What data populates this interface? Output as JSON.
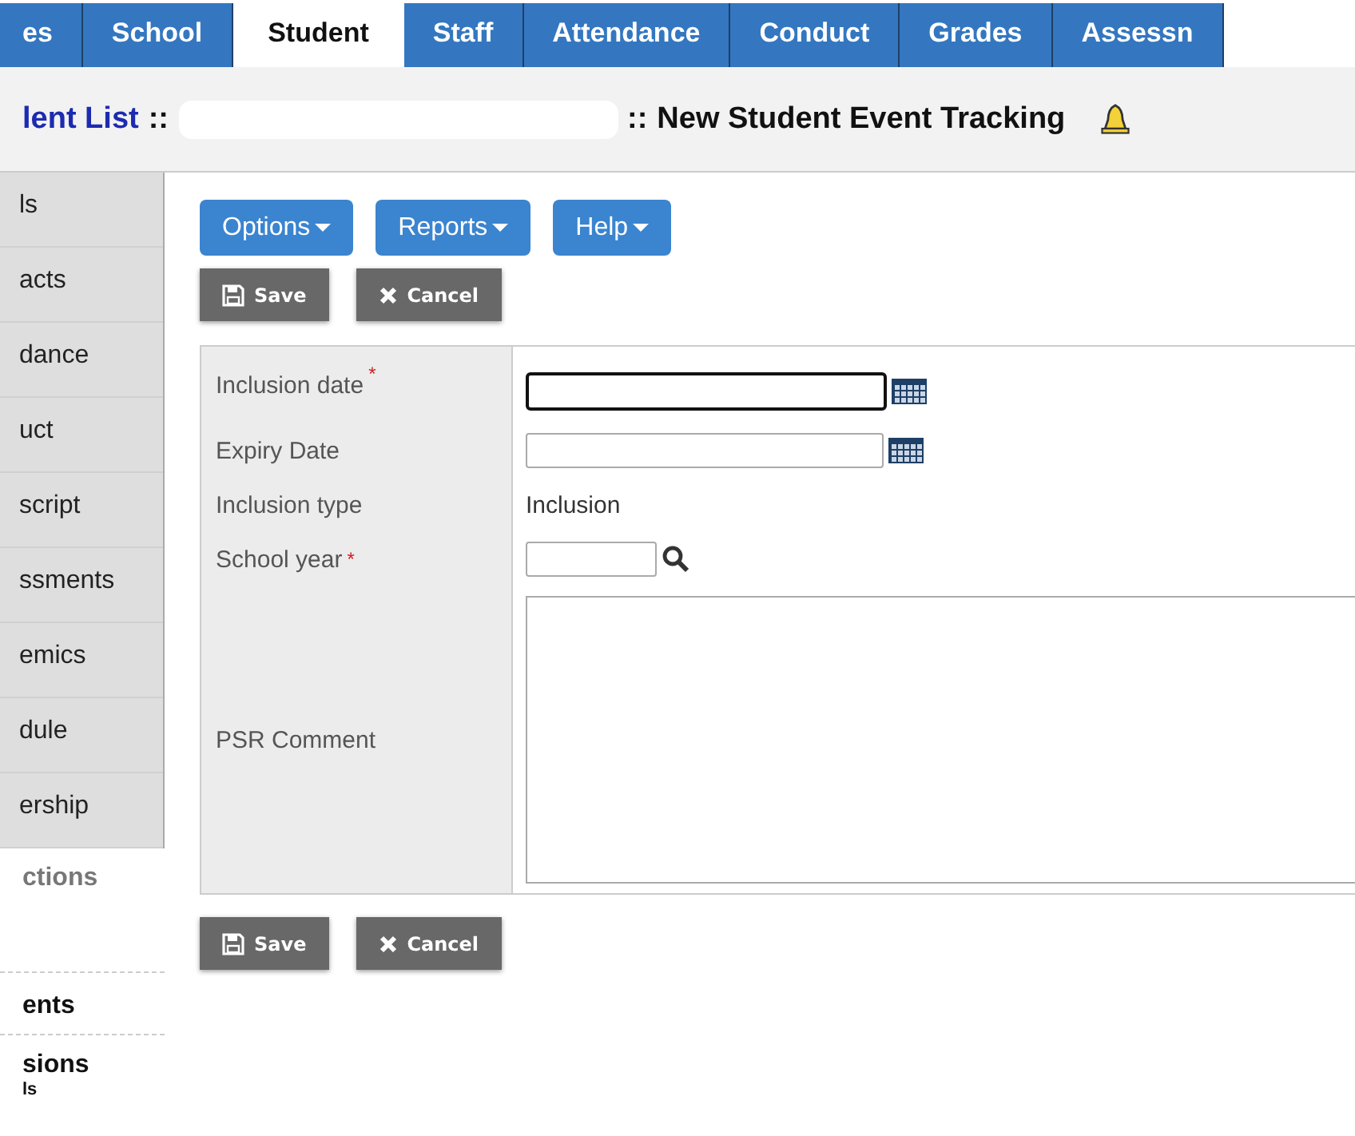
{
  "tabs": [
    {
      "label": "es",
      "selected": false
    },
    {
      "label": "School",
      "selected": false
    },
    {
      "label": "Student",
      "selected": true
    },
    {
      "label": "Staff",
      "selected": false
    },
    {
      "label": "Attendance",
      "selected": false
    },
    {
      "label": "Conduct",
      "selected": false
    },
    {
      "label": "Grades",
      "selected": false
    },
    {
      "label": "Assessn",
      "selected": false
    }
  ],
  "breadcrumb": {
    "link": "lent List",
    "separator": "::",
    "separator_2": "::",
    "title": "New Student Event Tracking"
  },
  "sidebar": {
    "items": [
      {
        "label": "ls"
      },
      {
        "label": "acts"
      },
      {
        "label": "dance"
      },
      {
        "label": "uct"
      },
      {
        "label": "script"
      },
      {
        "label": "ssments"
      },
      {
        "label": "emics"
      },
      {
        "label": "dule"
      },
      {
        "label": "ership"
      }
    ],
    "section_title": "ctions",
    "links": [
      {
        "label": "ents"
      },
      {
        "label": "sions",
        "sub": "ls"
      }
    ]
  },
  "menu_buttons": [
    "Options",
    "Reports",
    "Help"
  ],
  "actions": [
    "Save",
    "Cancel"
  ],
  "form": [
    {
      "kind": "date",
      "label": "Inclusion date",
      "required_mark": "*",
      "focused": true
    },
    {
      "kind": "date",
      "label": "Expiry Date",
      "focused": false
    },
    {
      "kind": "static",
      "label": "Inclusion type",
      "value": "Inclusion"
    },
    {
      "kind": "lookup",
      "label": "School year",
      "required_mark": "*",
      "focused": false
    },
    {
      "kind": "textarea",
      "label": "PSR Comment",
      "focused": false
    }
  ],
  "footer_actions": [
    "Save",
    "Cancel"
  ]
}
